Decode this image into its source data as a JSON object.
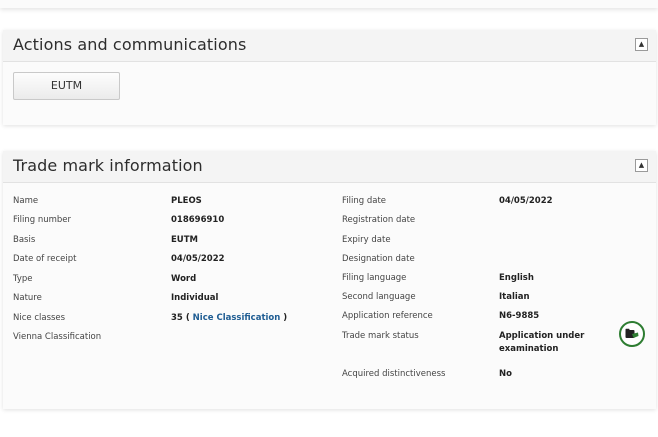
{
  "actions_panel": {
    "title": "Actions and communications",
    "collapse_symbol": "▲",
    "eutm_button": "EUTM"
  },
  "tm_panel": {
    "title": "Trade mark information",
    "collapse_symbol": "▲",
    "left": {
      "name_label": "Name",
      "name_value": "PLEOS",
      "filing_number_label": "Filing number",
      "filing_number_value": "018696910",
      "basis_label": "Basis",
      "basis_value": "EUTM",
      "date_of_receipt_label": "Date of receipt",
      "date_of_receipt_value": "04/05/2022",
      "type_label": "Type",
      "type_value": "Word",
      "nature_label": "Nature",
      "nature_value": "Individual",
      "nice_classes_label": "Nice classes",
      "nice_classes_number": "35",
      "nice_open_paren": "(",
      "nice_classification_link": "Nice Classification",
      "nice_close_paren": ")",
      "vienna_label": "Vienna Classification"
    },
    "right": {
      "filing_date_label": "Filing date",
      "filing_date_value": "04/05/2022",
      "registration_date_label": "Registration date",
      "expiry_date_label": "Expiry date",
      "designation_date_label": "Designation date",
      "filing_language_label": "Filing language",
      "filing_language_value": "English",
      "second_language_label": "Second language",
      "second_language_value": "Italian",
      "application_reference_label": "Application reference",
      "application_reference_value": "N6-9885",
      "status_label": "Trade mark status",
      "status_value_line1": "Application under",
      "status_value_line2": "examination",
      "acquired_label": "Acquired distinctiveness",
      "acquired_value": "No"
    },
    "status_icon": "status-application-icon",
    "status_icon_color": "#2e7d32"
  }
}
